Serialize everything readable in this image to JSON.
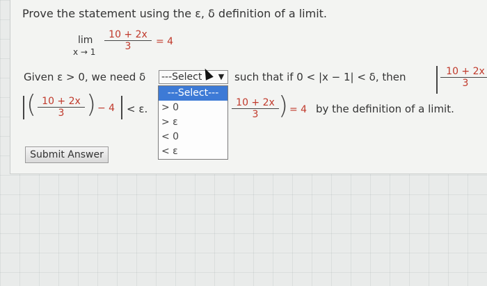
{
  "prompt": "Prove the statement using the ε, δ definition of a limit.",
  "limit": {
    "lim": "lim",
    "sub": "x → 1",
    "numerator": "10 + 2x",
    "denominator": "3",
    "equals": "= 4"
  },
  "line2": {
    "given": "Given ε > 0, we need δ",
    "such_that": "such that if 0 < |x − 1| < δ, then",
    "right_num": "10 + 2x",
    "right_den": "3"
  },
  "line3": {
    "num": "10 + 2x",
    "den": "3",
    "minus4": "− 4",
    "lt_eps": "< ε.",
    "num2": "10 + 2x",
    "den2": "3",
    "conclusion_eq": "= 4",
    "conclusion_text": "by the definition of a limit."
  },
  "select": {
    "current": "---Select",
    "options": [
      "---Select---",
      "> 0",
      "> ε",
      "< 0",
      "< ε"
    ]
  },
  "submit_label": "Submit Answer",
  "colors": {
    "accent_red": "#c0392b",
    "highlight": "#3d7ad6"
  }
}
